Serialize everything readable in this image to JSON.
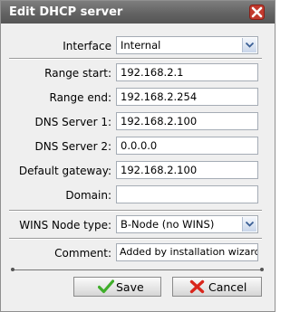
{
  "dialog": {
    "title": "Edit DHCP server",
    "close_icon": "close-x-icon"
  },
  "form": {
    "interface": {
      "label": "Interface",
      "value": "Internal"
    },
    "range_start": {
      "label": "Range start:",
      "value": "192.168.2.1"
    },
    "range_end": {
      "label": "Range end:",
      "value": "192.168.2.254"
    },
    "dns1": {
      "label": "DNS Server 1:",
      "value": "192.168.2.100"
    },
    "dns2": {
      "label": "DNS Server 2:",
      "value": "0.0.0.0"
    },
    "gateway": {
      "label": "Default gateway:",
      "value": "192.168.2.100"
    },
    "domain": {
      "label": "Domain:",
      "value": ""
    },
    "wins": {
      "label": "WINS Node type:",
      "value": "B-Node (no WINS)"
    },
    "comment": {
      "label": "Comment:",
      "value": "Added by installation wizard"
    }
  },
  "buttons": {
    "save": {
      "label": "Save",
      "icon": "checkmark-icon",
      "icon_color": "#3fae2a"
    },
    "cancel": {
      "label": "Cancel",
      "icon": "x-icon",
      "icon_color": "#d9261c"
    }
  }
}
